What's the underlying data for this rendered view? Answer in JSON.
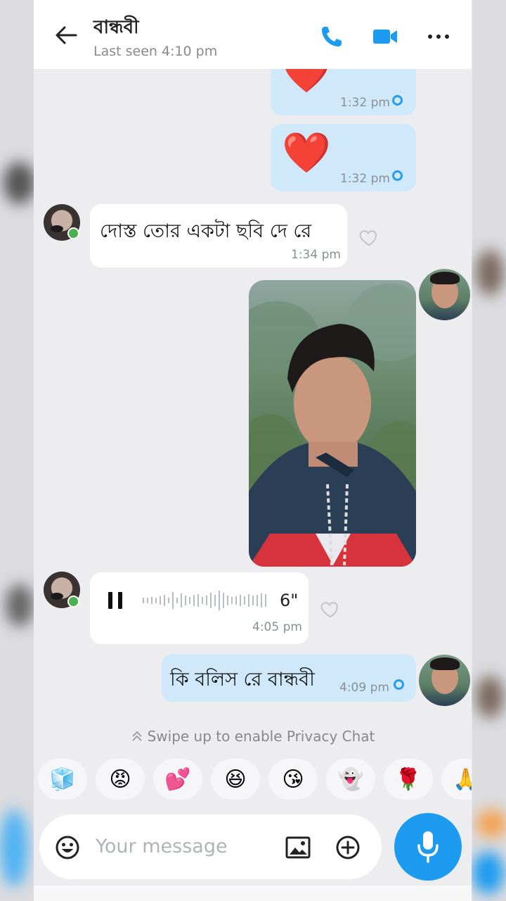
{
  "header": {
    "contact_name": "বান্ধবী",
    "last_seen": "Last seen 4:10 pm"
  },
  "messages": [
    {
      "type": "emoji",
      "direction": "out",
      "emoji": "❤️",
      "time": "1:32 pm"
    },
    {
      "type": "emoji",
      "direction": "out",
      "emoji": "❤️",
      "time": "1:32 pm"
    },
    {
      "type": "text",
      "direction": "in",
      "text": "দোস্ত তোর একটা ছবি দে রে",
      "time": "1:34 pm"
    },
    {
      "type": "image",
      "direction": "out"
    },
    {
      "type": "voice",
      "direction": "in",
      "duration": "6\"",
      "time": "4:05 pm"
    },
    {
      "type": "text",
      "direction": "out",
      "text": "কি বলিস রে বান্ধবী",
      "time": "4:09 pm"
    }
  ],
  "privacy_hint": "Swipe up to enable Privacy Chat",
  "quick_emojis": [
    "🧊",
    "😡",
    "💕",
    "😆",
    "😘",
    "👻",
    "🌹",
    "🙏"
  ],
  "composer": {
    "placeholder": "Your message"
  },
  "colors": {
    "accent": "#1d9bf0",
    "outgoing_bubble": "#cfe9fb",
    "incoming_bubble": "#ffffff"
  },
  "icons": [
    "back-arrow-icon",
    "phone-icon",
    "video-call-icon",
    "more-icon",
    "heart-icon",
    "pause-icon",
    "emoji-icon",
    "gallery-icon",
    "add-icon",
    "mic-icon",
    "double-chevron-up-icon"
  ]
}
